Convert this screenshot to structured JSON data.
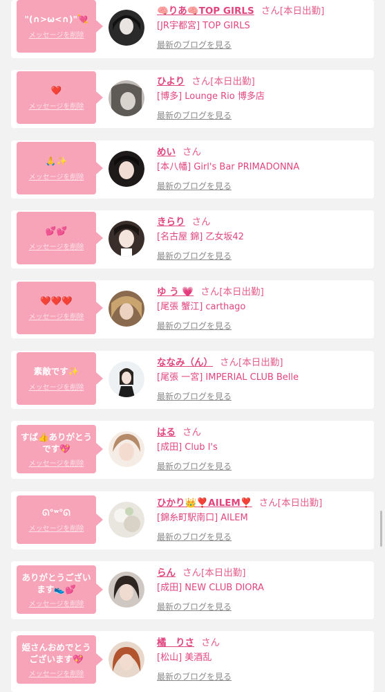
{
  "delete_label": "メッセージを削除",
  "blog_label": "最新のブログを見る",
  "colors": {
    "accent": "#e0457e",
    "bubble": "#f7a3b8"
  },
  "cards": [
    {
      "message": "\"(∩>ω<∩)\"💘",
      "name": "🧠りあ🧠TOP GIRLS",
      "suffix": "さん[本日出勤]",
      "shop": "[JR宇都宮] TOP GIRLS"
    },
    {
      "message": "❤️",
      "name": "ひより",
      "suffix": "さん[本日出勤]",
      "shop": "[博多] Lounge Rio 博多店"
    },
    {
      "message": "🙏✨",
      "name": "めい",
      "suffix": "さん",
      "shop": "[本八幡] Girl's Bar PRIMADONNA"
    },
    {
      "message": "💕💕",
      "name": "きらり",
      "suffix": "さん",
      "shop": "[名古屋 錦] 乙女坂42"
    },
    {
      "message": "❤️❤️❤️",
      "name": "ゆ う 💗",
      "suffix": "さん[本日出勤]",
      "shop": "[尾張 蟹江] carthago"
    },
    {
      "message": "素敵です✨",
      "name": "ななみ（ん）",
      "suffix": "さん[本日出勤]",
      "shop": "[尾張 一宮] IMPERIAL CLUB Belle"
    },
    {
      "message": "すば👍ありがとうです💖",
      "name": "はる",
      "suffix": "さん",
      "shop": "[成田] Club I's"
    },
    {
      "message": "ᘏ°ʷ°ᘏ",
      "name": "ひかり👑❣️AILEM❣️",
      "suffix": "さん[本日出勤]",
      "shop": "[錦糸町駅南口] AILEM"
    },
    {
      "message": "ありがとうございます👟💕",
      "name": "らん",
      "suffix": "さん[本日出勤]",
      "shop": "[成田] NEW CLUB DIORA"
    },
    {
      "message": "姫さんおめでとうございます💖",
      "name": "橘　りさ",
      "suffix": "さん",
      "shop": "[松山] 美酒乱"
    }
  ]
}
